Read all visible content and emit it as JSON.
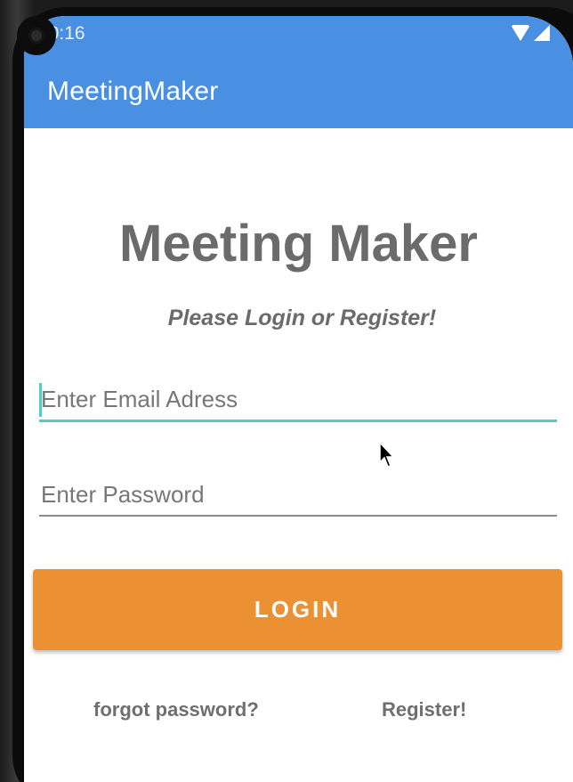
{
  "status_bar": {
    "time": "10:16",
    "icons": [
      "wifi-icon",
      "signal-icon"
    ],
    "background": "#4a90e2"
  },
  "app_bar": {
    "title": "MeetingMaker",
    "background": "#4a90e2"
  },
  "main": {
    "heading": "Meeting Maker",
    "subheading": "Please Login or Register!",
    "email_field": {
      "value": "",
      "placeholder": "Enter Email Adress",
      "focused": true
    },
    "password_field": {
      "value": "",
      "placeholder": "Enter Password"
    },
    "login_button": {
      "label": "LOGIN",
      "color": "#ec9133"
    },
    "links": {
      "forgot_password": "forgot password?",
      "register": "Register!"
    }
  },
  "colors": {
    "accent_focus": "#4ecfbf",
    "text_gray": "#6b6b6b"
  }
}
